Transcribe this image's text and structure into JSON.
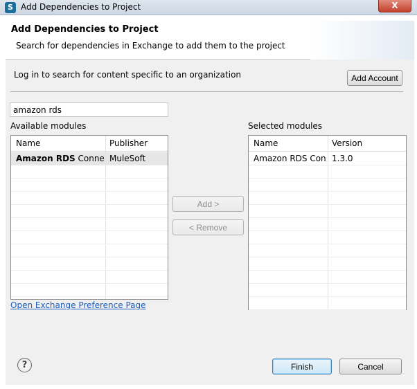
{
  "window": {
    "title": "Add Dependencies to Project",
    "close_label": "X"
  },
  "header": {
    "title": "Add Dependencies to Project",
    "subtitle": "Search for dependencies in Exchange to add them to the project"
  },
  "login": {
    "text": "Log in to search for content specific to an organization",
    "add_account_label": "Add Account"
  },
  "search": {
    "value": "amazon rds"
  },
  "available": {
    "label": "Available modules",
    "columns": [
      "Name",
      "Publisher"
    ],
    "rows": [
      {
        "name_bold": "Amazon RDS",
        "name_rest": " Connecto",
        "publisher": "MuleSoft"
      }
    ]
  },
  "selected": {
    "label": "Selected modules",
    "columns": [
      "Name",
      "Version"
    ],
    "rows": [
      {
        "name": "Amazon RDS Con...",
        "version": "1.3.0"
      }
    ]
  },
  "actions": {
    "add_label": "Add >",
    "remove_label": "< Remove"
  },
  "link": {
    "preferences": "Open Exchange Preference Page"
  },
  "footer": {
    "help_symbol": "?",
    "finish_label": "Finish",
    "cancel_label": "Cancel"
  }
}
